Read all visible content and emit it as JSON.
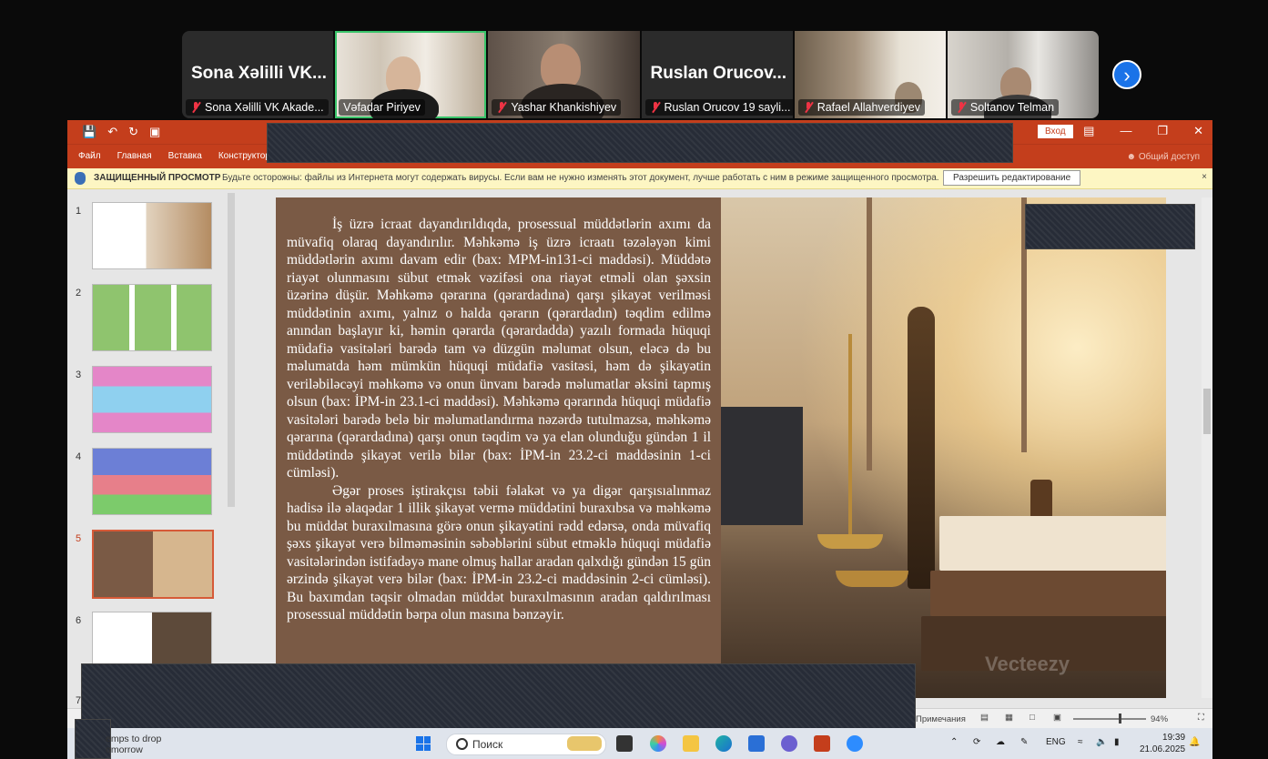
{
  "meeting": {
    "participants": [
      {
        "big_name": "Sona Xəlilli VK...",
        "caption": "Sona Xəlilli VK Akade..."
      },
      {
        "big_name": "",
        "caption": "Vəfadar Piriyev"
      },
      {
        "big_name": "",
        "caption": "Yashar Khankishiyev"
      },
      {
        "big_name": "Ruslan  Orucov...",
        "caption": "Ruslan Orucov 19 sayli..."
      },
      {
        "big_name": "",
        "caption": "Rafael Allahverdiyev"
      },
      {
        "big_name": "",
        "caption": "Soltanov Telman"
      }
    ],
    "next_label": "›"
  },
  "ppt": {
    "signin": "Вход",
    "tabs": [
      "Файл",
      "Главная",
      "Вставка",
      "Конструктор"
    ],
    "share": "Общий доступ",
    "protected_title": "ЗАЩИЩЕННЫЙ ПРОСМОТР",
    "protected_text": "Будьте осторожны: файлы из Интернета могут содержать вирусы. Если вам не нужно изменять этот документ, лучше работать с ним в режиме защищенного просмотра.",
    "enable_editing": "Разрешить редактирование",
    "close": "×",
    "thumb_numbers": [
      "1",
      "2",
      "3",
      "4",
      "5",
      "6",
      "7"
    ],
    "slide_paragraphs": [
      "İş üzrə icraat dayandırıldıqda, prosessual müddətlərin axımı da müvafiq olaraq dayandırılır. Məhkəmə iş üzrə icraatı təzələyən kimi müddətlərin axımı davam edir (bax: MPM-in131-ci maddəsi). Müddətə riayət olunmasını sübut etmək vəzifəsi ona riayət etməli olan şəxsin üzərinə düşür. Məhkəmə qərarına (qərardadına) qarşı şikayət verilməsi müddətinin axımı, yalnız o halda qərarın (qərardadın) təqdim edilmə anından başlayır ki, həmin qərarda (qərardadda) yazılı formada hüquqi müdafiə vasitələri barədə tam və düzgün məlumat olsun, eləcə də bu məlumatda həm mümkün hüquqi müdafiə vasitəsi, həm də şikayətin veriləbiləcəyi məhkəmə və onun ünvanı barədə məlumatlar əksini tapmış olsun (bax: İPM-in 23.1-ci maddəsi). Məhkəmə qərarında hüquqi müdafiə vasitələri barədə belə bir məlumatlandırma nəzərdə tutulmazsa, məhkəmə qərarına (qərardadına) qarşı onun təqdim və ya elan olunduğu gündən 1 il müddətində şikayət verilə bilər (bax: İPM-in 23.2-ci maddəsinin 1-ci cümləsi).",
      "Əgər proses iştirakçısı təbii fəlakət və ya digər qarşısıalınmaz hadisə ilə əlaqədar 1 illik şikayət vermə müddətini buraxıbsa və məhkəmə bu müddət buraxılmasına görə onun şikayətini rədd edərsə, onda müvafiq şəxs şikayət verə bilməməsinin səbəblərini sübut etməklə hüquqi müdafiə vasitələrindən istifadəyə mane olmuş hallar aradan qalxdığı gündən 15 gün ərzində şikayət verə bilər (bax: İPM-in 23.2-ci maddəsinin 2-ci cümləsi). Bu baxımdan təqsir olmadan müddət buraxılmasının aradan qaldırılması prosessual müddətin bərpa olun masına bənzəyir."
    ],
    "watermark": "Vecteezy",
    "status_notes": "Примечания",
    "zoom": "94%"
  },
  "taskbar": {
    "weather_line1": "emps to drop",
    "weather_line2": "omorrow",
    "search_placeholder": "Поиск",
    "lang": "ENG",
    "time": "19:39",
    "date": "21.06.2025"
  },
  "colors": {
    "ppt_red": "#c43e1c",
    "slide_panel": "#7a5a45",
    "active_speaker": "#39c46a"
  }
}
